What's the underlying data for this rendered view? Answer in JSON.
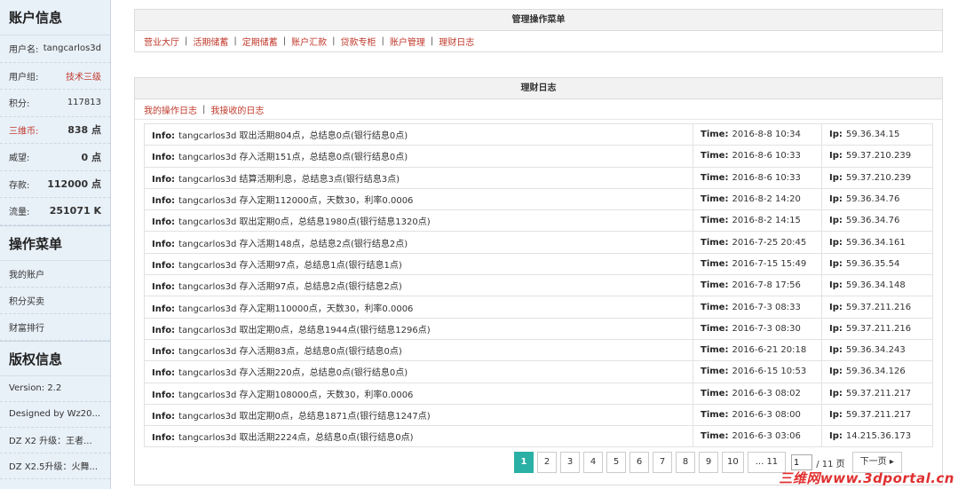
{
  "sidebar": {
    "account_title": "账户信息",
    "account": [
      {
        "label": "用户名:",
        "value": "tangcarlos3d"
      },
      {
        "label": "用户组:",
        "value": "技术三级"
      },
      {
        "label": "积分:",
        "value": "117813"
      },
      {
        "label": "三维币:",
        "value": "838 点"
      },
      {
        "label": "威望:",
        "value": "0 点"
      },
      {
        "label": "存款:",
        "value": "112000 点"
      },
      {
        "label": "流量:",
        "value": "251071 K"
      }
    ],
    "menu_title": "操作菜单",
    "menu": [
      "我的账户",
      "积分买卖",
      "财富排行"
    ],
    "copyright_title": "版权信息",
    "copyright": [
      "Version: 2.2",
      "Designed by Wz20...",
      "DZ X2 升级：王者...",
      "DZ X2.5升级：火舞..."
    ]
  },
  "admin_menu": {
    "title": "管理操作菜单",
    "links": [
      "营业大厅",
      "活期储蓄",
      "定期储蓄",
      "账户汇款",
      "贷款专柜",
      "账户管理",
      "理财日志"
    ]
  },
  "log": {
    "title": "理财日志",
    "links": [
      "我的操作日志",
      "我接收的日志"
    ],
    "info_label": "Info:",
    "time_label": "Time:",
    "ip_label": "Ip:",
    "rows": [
      {
        "info": "tangcarlos3d 取出活期804点，总结息0点(银行结息0点)",
        "time": "2016-8-8 10:34",
        "ip": "59.36.34.15"
      },
      {
        "info": "tangcarlos3d 存入活期151点，总结息0点(银行结息0点)",
        "time": "2016-8-6 10:33",
        "ip": "59.37.210.239"
      },
      {
        "info": "tangcarlos3d 结算活期利息，总结息3点(银行结息3点)",
        "time": "2016-8-6 10:33",
        "ip": "59.37.210.239"
      },
      {
        "info": "tangcarlos3d 存入定期112000点，天数30，利率0.0006",
        "time": "2016-8-2 14:20",
        "ip": "59.36.34.76"
      },
      {
        "info": "tangcarlos3d 取出定期0点，总结息1980点(银行结息1320点)",
        "time": "2016-8-2 14:15",
        "ip": "59.36.34.76"
      },
      {
        "info": "tangcarlos3d 存入活期148点，总结息2点(银行结息2点)",
        "time": "2016-7-25 20:45",
        "ip": "59.36.34.161"
      },
      {
        "info": "tangcarlos3d 存入活期97点，总结息1点(银行结息1点)",
        "time": "2016-7-15 15:49",
        "ip": "59.36.35.54"
      },
      {
        "info": "tangcarlos3d 存入活期97点，总结息2点(银行结息2点)",
        "time": "2016-7-8 17:56",
        "ip": "59.36.34.148"
      },
      {
        "info": "tangcarlos3d 存入定期110000点，天数30，利率0.0006",
        "time": "2016-7-3 08:33",
        "ip": "59.37.211.216"
      },
      {
        "info": "tangcarlos3d 取出定期0点，总结息1944点(银行结息1296点)",
        "time": "2016-7-3 08:30",
        "ip": "59.37.211.216"
      },
      {
        "info": "tangcarlos3d 存入活期83点，总结息0点(银行结息0点)",
        "time": "2016-6-21 20:18",
        "ip": "59.36.34.243"
      },
      {
        "info": "tangcarlos3d 存入活期220点，总结息0点(银行结息0点)",
        "time": "2016-6-15 10:53",
        "ip": "59.36.34.126"
      },
      {
        "info": "tangcarlos3d 存入定期108000点，天数30，利率0.0006",
        "time": "2016-6-3 08:02",
        "ip": "59.37.211.217"
      },
      {
        "info": "tangcarlos3d 取出定期0点，总结息1871点(银行结息1247点)",
        "time": "2016-6-3 08:00",
        "ip": "59.37.211.217"
      },
      {
        "info": "tangcarlos3d 取出活期2224点，总结息0点(银行结息0点)",
        "time": "2016-6-3 03:06",
        "ip": "14.215.36.173"
      }
    ]
  },
  "pager": {
    "pages": [
      "1",
      "2",
      "3",
      "4",
      "5",
      "6",
      "7",
      "8",
      "9",
      "10",
      "... 11"
    ],
    "current": "1",
    "input_value": "1",
    "total": "/ 11 页",
    "next": "下一页 ▸"
  },
  "watermark": "三维网www.3dportal.cn"
}
